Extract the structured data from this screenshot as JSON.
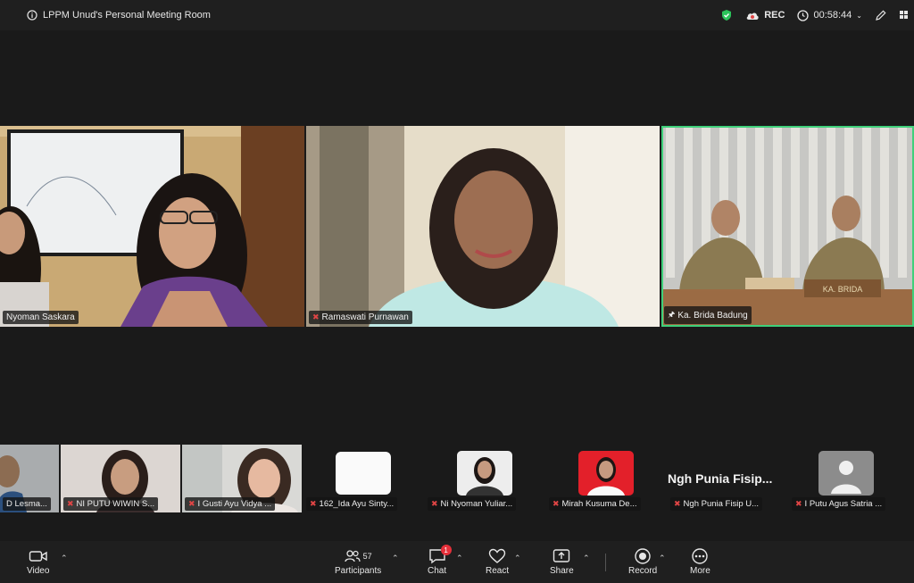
{
  "meeting": {
    "room_name": "LPPM Unud's Personal Meeting Room",
    "rec_label": "REC",
    "timer": "00:58:44"
  },
  "main_tiles": [
    {
      "name": "Nyoman Saskara"
    },
    {
      "name": "Ramaswati Purnawan"
    },
    {
      "name": "Ka. Brida Badung",
      "sign_text": "KA. BRIDA"
    }
  ],
  "strip_tiles": [
    {
      "name": "D Lesma..."
    },
    {
      "name": "NI PUTU WIWIN S..."
    },
    {
      "name": "I Gusti Ayu Vidya ..."
    },
    {
      "name": "162_Ida Ayu Sinty..."
    },
    {
      "name": "Ni Nyoman Yuliar..."
    },
    {
      "name": "Mirah Kusuma De..."
    },
    {
      "name": "Ngh Punia Fisip U...",
      "display": "Ngh Punia Fisip..."
    },
    {
      "name": "I Putu Agus Satria ..."
    }
  ],
  "toolbar": {
    "video": "Video",
    "participants": "Participants",
    "participants_count": "57",
    "chat": "Chat",
    "chat_badge": "1",
    "react": "React",
    "share": "Share",
    "record": "Record",
    "more": "More"
  },
  "colors": {
    "active_speaker": "#3fd07a",
    "mic_muted": "#e04545",
    "shield": "#2bc35a"
  }
}
